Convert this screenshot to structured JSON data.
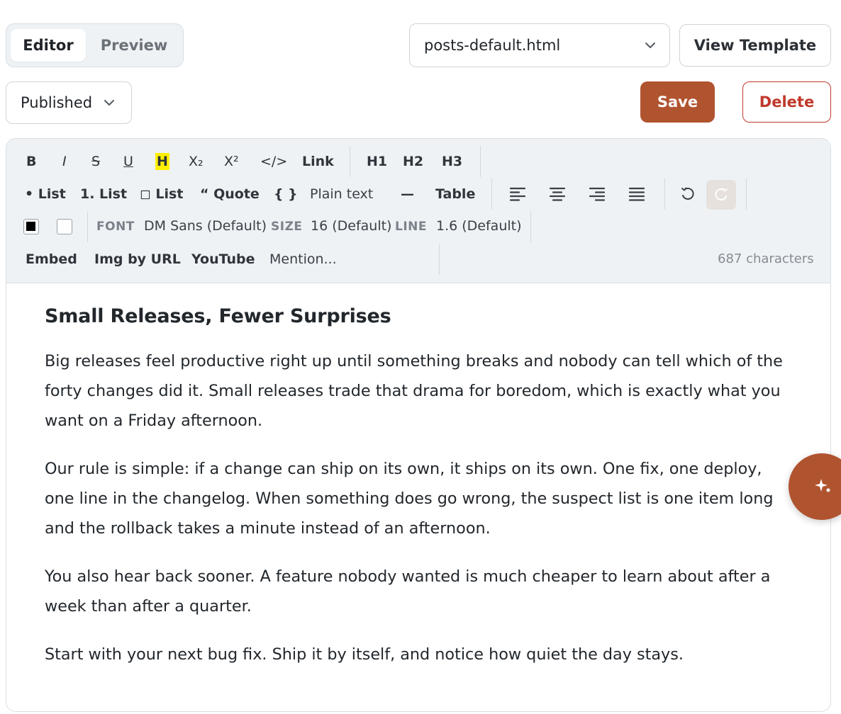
{
  "mode_tabs": {
    "editor": "Editor",
    "preview": "Preview"
  },
  "template_select": {
    "value": "posts-default.html"
  },
  "view_template_label": "View Template",
  "status_select": {
    "value": "Published"
  },
  "save_label": "Save",
  "delete_label": "Delete",
  "toolbar": {
    "bold": "B",
    "italic": "I",
    "strike": "S",
    "underline": "U",
    "highlight": "H",
    "subscript": "X₂",
    "superscript": "X²",
    "code": "</>",
    "link": "Link",
    "h1": "H1",
    "h2": "H2",
    "h3": "H3",
    "bullet_list": "• List",
    "numbered_list": "1. List",
    "check_list": "◻ List",
    "quote": "“ Quote",
    "code_block": "{ }",
    "plain_text": "Plain text",
    "hr": "—",
    "table": "Table",
    "font_label": "FONT",
    "font_value": "DM Sans (Default)",
    "size_label": "SIZE",
    "size_value": "16 (Default)",
    "line_label": "LINE",
    "line_value": "1.6 (Default)",
    "embed": "Embed",
    "img_url": "Img by URL",
    "youtube": "YouTube",
    "mention": "Mention...",
    "char_count": "687 characters",
    "text_color": "#000000",
    "bg_color": "#ffffff"
  },
  "content": {
    "title": "Small Releases, Fewer Surprises",
    "paragraphs": [
      "Big releases feel productive right up until something breaks and nobody can tell which of the forty changes did it. Small releases trade that drama for boredom, which is exactly what you want on a Friday afternoon.",
      "Our rule is simple: if a change can ship on its own, it ships on its own. One fix, one deploy, one line in the changelog. When something does go wrong, the suspect list is one item long and the rollback takes a minute instead of an afternoon.",
      "You also hear back sooner. A feature nobody wanted is much cheaper to learn about after a week than after a quarter.",
      "Start with your next bug fix. Ship it by itself, and notice how quiet the day stays."
    ]
  },
  "colors": {
    "accent": "#b0532f",
    "danger": "#c0392b",
    "highlight": "#ffef00"
  },
  "ai_button_icon": "sparkle-icon"
}
